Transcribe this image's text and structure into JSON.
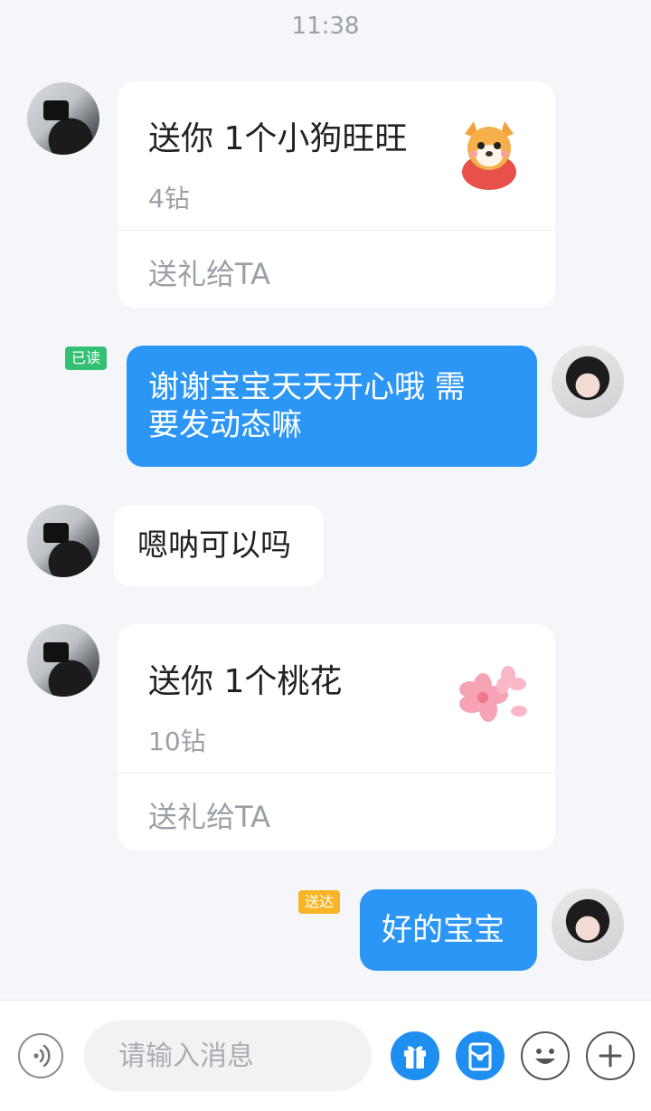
{
  "timestamp": "11:38",
  "messages": [
    {
      "type": "gift",
      "sender": "other",
      "gift_name": "送你 1个小狗旺旺",
      "price": "4钻",
      "action_label": "送礼给TA",
      "gift_icon": "puppy-gift-icon"
    },
    {
      "type": "text",
      "sender": "self",
      "status": "已读",
      "text_line1": "谢谢宝宝天天开心哦 需",
      "text_line2": "要发动态嘛"
    },
    {
      "type": "text",
      "sender": "other",
      "text": "嗯呐可以吗"
    },
    {
      "type": "gift",
      "sender": "other",
      "gift_name": "送你 1个桃花",
      "price": "10钻",
      "action_label": "送礼给TA",
      "gift_icon": "peach-blossom-icon"
    },
    {
      "type": "text",
      "sender": "self",
      "status": "送达",
      "text": "好的宝宝"
    }
  ],
  "input": {
    "placeholder": "请输入消息",
    "value": ""
  },
  "toolbar": {
    "voice_icon": "voice-icon",
    "gift_icon": "gift-icon",
    "red_packet_icon": "red-packet-icon",
    "emoji_icon": "emoji-icon",
    "plus_icon": "plus-icon"
  },
  "colors": {
    "accent": "#2b96f5",
    "read_badge": "#33c073",
    "delivered_badge": "#f7b526",
    "background": "#f4f6f9"
  }
}
